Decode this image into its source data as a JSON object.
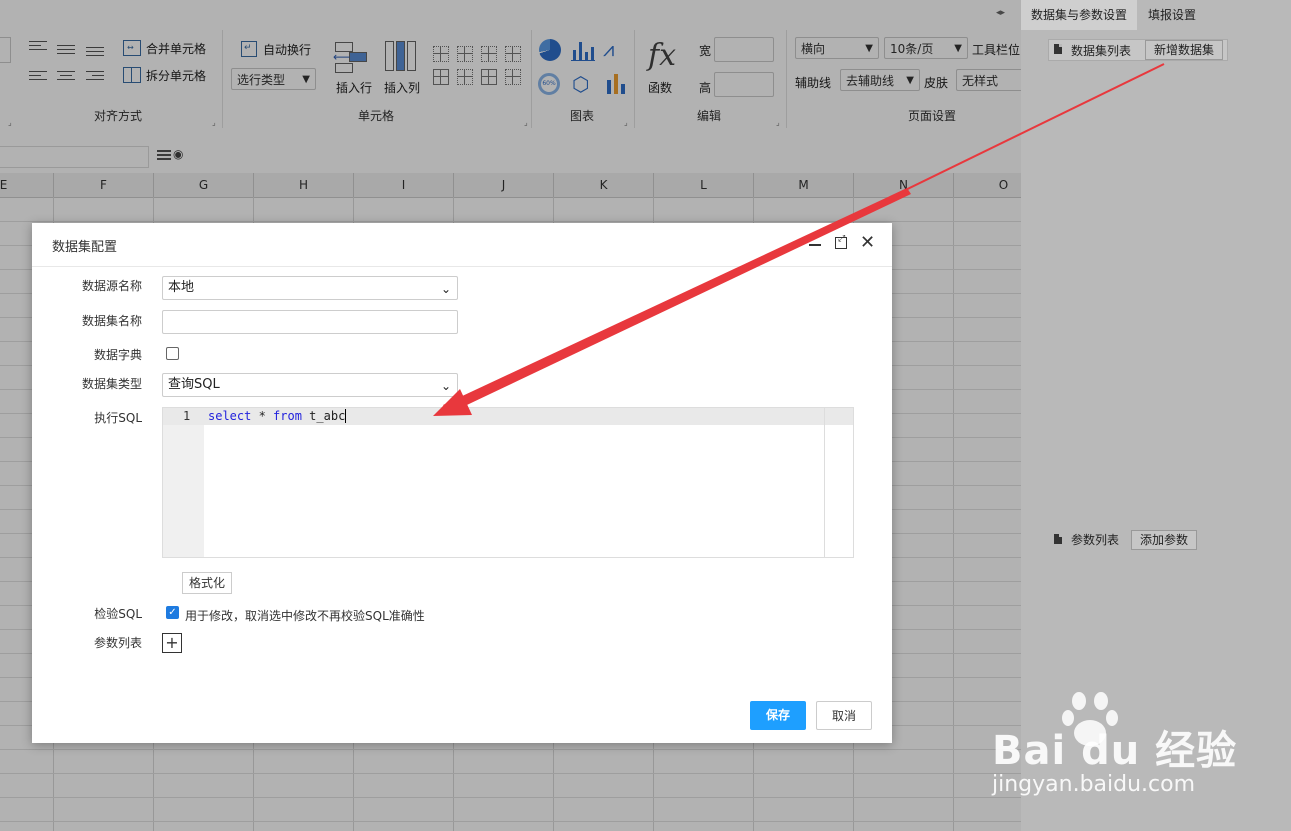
{
  "ribbon": {
    "merge_cells": "合并单元格",
    "split_cells": "拆分单元格",
    "auto_wrap": "自动换行",
    "select_type": "选行类型",
    "insert_row": "插入行",
    "insert_col": "插入列",
    "functions": "函数",
    "width_label": "宽",
    "height_label": "高",
    "orientation": "横向",
    "page_size": "10条/页",
    "toolbar_pos": "工具栏位",
    "guides_label": "辅助线",
    "guides_value": "去辅助线",
    "skin_label": "皮肤",
    "skin_value": "无样式",
    "groups": {
      "align": "对齐方式",
      "cell": "单元格",
      "chart": "图表",
      "edit": "编辑",
      "page": "页面设置"
    }
  },
  "columns": [
    "E",
    "F",
    "G",
    "H",
    "I",
    "J",
    "K",
    "L",
    "M",
    "N",
    "O"
  ],
  "right_panel": {
    "tabs": [
      "数据集与参数设置",
      "填报设置"
    ],
    "dataset_list": "数据集列表",
    "new_dataset": "新增数据集",
    "param_list": "参数列表",
    "add_param": "添加参数"
  },
  "dialog": {
    "title": "数据集配置",
    "fields": {
      "source_label": "数据源名称",
      "source_value": "本地",
      "name_label": "数据集名称",
      "name_value": "",
      "dict_label": "数据字典",
      "type_label": "数据集类型",
      "type_value": "查询SQL",
      "sql_label": "执行SQL",
      "sql_line_no": "1",
      "sql_keyword1": "select",
      "sql_mid": " * ",
      "sql_keyword2": "from",
      "sql_table": " t_abc",
      "format_btn": "格式化",
      "check_label": "检验SQL",
      "check_text": "用于修改，取消选中修改不再校验SQL准确性",
      "param_label": "参数列表"
    },
    "save": "保存",
    "cancel": "取消"
  },
  "watermark": {
    "brand": "Bai du 经验",
    "url": "jingyan.baidu.com"
  },
  "colors": {
    "primary": "#1e9fff",
    "arrow": "#e8383d",
    "keyword": "#0000ff"
  }
}
